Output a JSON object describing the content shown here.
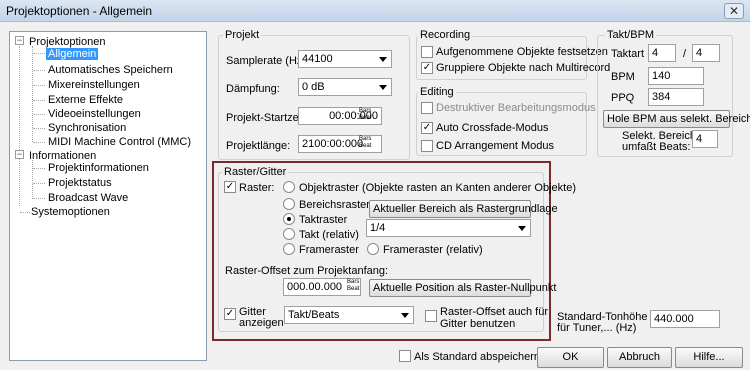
{
  "window": {
    "title": "Projektoptionen - Allgemein",
    "close": "✕"
  },
  "tree": {
    "projektoptionen": "Projektoptionen",
    "allgemein": "Allgemein",
    "auto_save": "Automatisches Speichern",
    "mixer": "Mixereinstellungen",
    "effekte": "Externe Effekte",
    "video": "Videoeinstellungen",
    "sync": "Synchronisation",
    "mmc": "MIDI Machine Control (MMC)",
    "informationen": "Informationen",
    "projektinfo": "Projektinformationen",
    "projektstatus": "Projektstatus",
    "broadcast": "Broadcast Wave",
    "system": "Systemoptionen",
    "minus": "−",
    "plus": "+"
  },
  "projekt": {
    "title": "Projekt",
    "samplerate_label": "Samplerate (Hz):",
    "samplerate_value": "44100",
    "daempfung_label": "Dämpfung:",
    "daempfung_value": "0 dB",
    "startzeit_label": "Projekt-Startzeit:",
    "startzeit_value": "00:00:000",
    "laenge_label": "Projektlänge:",
    "laenge_value": "2100:00:000",
    "bars": "Bars",
    "beat": "Beat"
  },
  "recording": {
    "title": "Recording",
    "festsetzen": "Aufgenommene Objekte festsetzen",
    "festsetzen_checked": false,
    "gruppiere": "Gruppiere Objekte nach Multirecord",
    "gruppiere_checked": true
  },
  "editing": {
    "title": "Editing",
    "destruktiv": "Destruktiver Bearbeitungsmodus",
    "destruktiv_checked": false,
    "crossfade": "Auto Crossfade-Modus",
    "crossfade_checked": true,
    "cd": "CD Arrangement Modus",
    "cd_checked": false
  },
  "takt": {
    "title": "Takt/BPM",
    "taktart_label": "Taktart",
    "taktart_num": "4",
    "slash": "/",
    "taktart_den": "4",
    "bpm_label": "BPM",
    "bpm_value": "140",
    "ppq_label": "PPQ",
    "ppq_value": "384",
    "hole_bpm": "Hole BPM aus selekt. Bereich",
    "selekt_line1": "Selekt. Bereich",
    "selekt_line2": "umfaßt Beats:",
    "beats_value": "4"
  },
  "raster": {
    "title": "Raster/Gitter",
    "raster_label": "Raster:",
    "raster_checked": true,
    "objektraster": "Objektraster (Objekte rasten an Kanten anderer Objekte)",
    "bereichsraster": "Bereichsraster",
    "aktueller_bereich": "Aktueller Bereich als Rastergrundlage",
    "taktraster": "Taktraster",
    "takt_relativ": "Takt (relativ)",
    "framerraster": "Frameraster",
    "frameraster_relativ": "Frameraster (relativ)",
    "raster_value": "1/4",
    "offset_label": "Raster-Offset zum Projektanfang:",
    "offset_value": "000.00.000",
    "aktuelle_position": "Aktuelle Position als Raster-Nullpunkt",
    "gitter_line1": "Gitter",
    "gitter_line2": "anzeigen",
    "gitter_checked": true,
    "gitter_value": "Takt/Beats",
    "offset_auch_line1": "Raster-Offset auch für",
    "offset_auch_line2": "Gitter benutzen",
    "offset_auch_checked": false
  },
  "tonhoehe": {
    "line1": "Standard-Tonhöhe",
    "line2": "für Tuner,... (Hz)",
    "value": "440.000"
  },
  "footer": {
    "standard_label": "Als Standard abspeichern",
    "standard_checked": false,
    "ok": "OK",
    "abbruch": "Abbruch",
    "hilfe": "Hilfe..."
  },
  "checkmark": "✓"
}
